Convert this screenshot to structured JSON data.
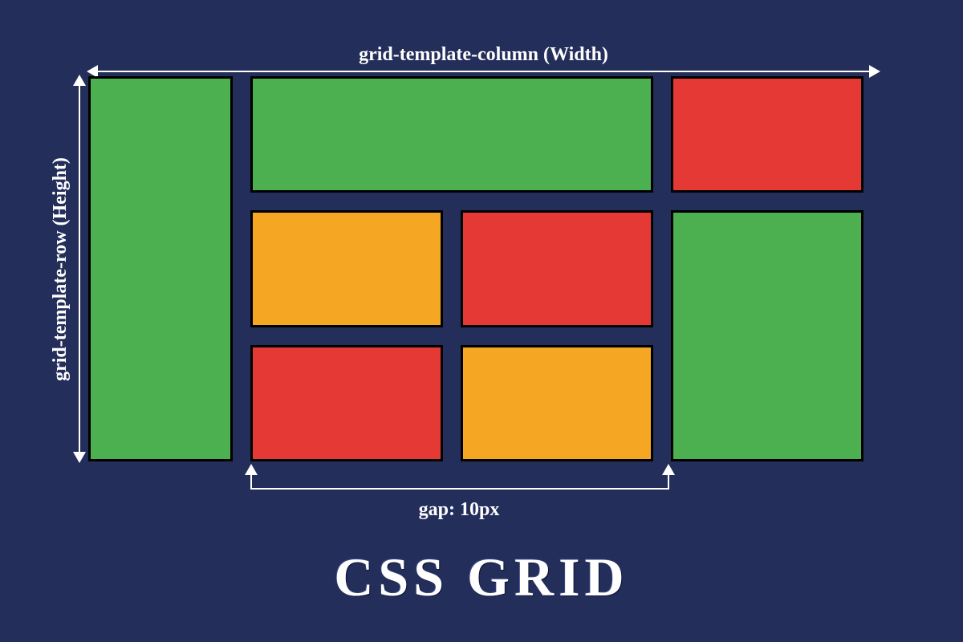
{
  "labels": {
    "column": "grid-template-column (Width)",
    "row": "grid-template-row (Height)",
    "gap": "gap: 10px"
  },
  "title": "CSS GRID",
  "cells": [
    {
      "name": "cell-1",
      "color": "green"
    },
    {
      "name": "cell-2",
      "color": "green"
    },
    {
      "name": "cell-3",
      "color": "red"
    },
    {
      "name": "cell-4",
      "color": "orange"
    },
    {
      "name": "cell-5",
      "color": "red"
    },
    {
      "name": "cell-6",
      "color": "green"
    },
    {
      "name": "cell-7",
      "color": "red"
    },
    {
      "name": "cell-8",
      "color": "orange"
    }
  ],
  "colors": {
    "background": "#242e5a",
    "green": "#4caf50",
    "red": "#e53935",
    "orange": "#f5a623",
    "stroke": "#000000",
    "text": "#ffffff"
  }
}
